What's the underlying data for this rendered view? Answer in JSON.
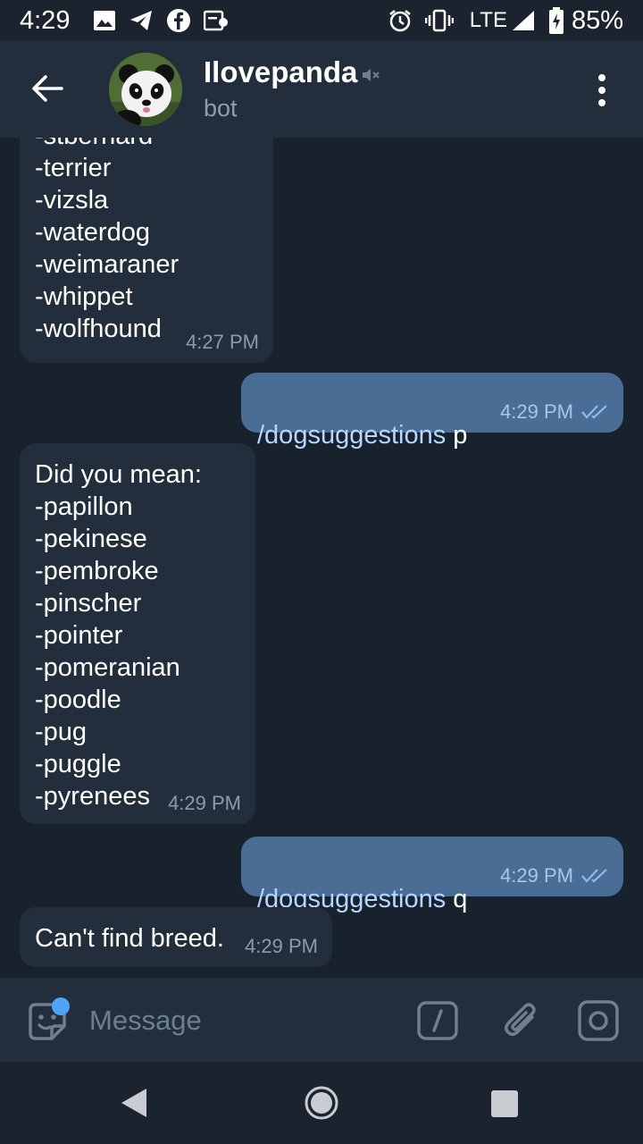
{
  "status_bar": {
    "time": "4:29",
    "network": "LTE",
    "battery": "85%"
  },
  "header": {
    "title": "Ilovepanda",
    "subtitle": "bot"
  },
  "messages": [
    {
      "direction": "in",
      "text": "-stbernard\n-terrier\n-vizsla\n-waterdog\n-weimaraner\n-whippet\n-wolfhound",
      "time": "4:27 PM"
    },
    {
      "direction": "out",
      "command": "/dogsuggestions",
      "arg": " p",
      "time": "4:29 PM"
    },
    {
      "direction": "in",
      "text": "Did you mean:\n-papillon\n-pekinese\n-pembroke\n-pinscher\n-pointer\n-pomeranian\n-poodle\n-pug\n-puggle\n-pyrenees",
      "time": "4:29 PM"
    },
    {
      "direction": "out",
      "command": "/dogsuggestions",
      "arg": " q",
      "time": "4:29 PM"
    },
    {
      "direction": "in",
      "text": "Can't find breed.",
      "time": "4:29 PM"
    }
  ],
  "input": {
    "placeholder": "Message"
  },
  "colors": {
    "background": "#18222d",
    "incoming_bubble": "#222e3b",
    "outgoing_bubble": "#4a6d95",
    "accent": "#4ea4f6"
  }
}
